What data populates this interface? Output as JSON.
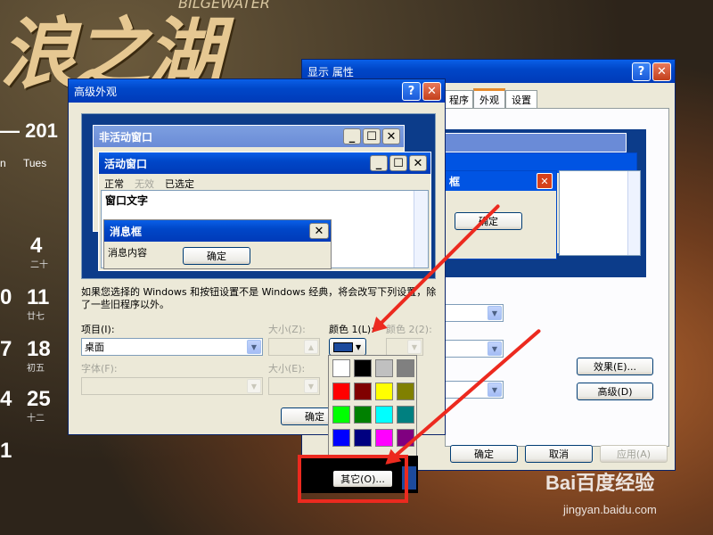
{
  "wallpaper": {
    "banner": "浪之湖",
    "subtitle": "BILGEWATER",
    "year": "— 201",
    "day_tue": "Tues",
    "day_n": "n",
    "dates": [
      {
        "n": "4",
        "l": "二十"
      },
      {
        "n": "11",
        "l": "廿七"
      },
      {
        "n": "18",
        "l": "初五"
      },
      {
        "n": "25",
        "l": "十二"
      }
    ],
    "left_nums": [
      "0",
      "7",
      "4",
      "1"
    ]
  },
  "display_window": {
    "title": "显示 属性",
    "tabs": [
      "程序",
      "外观",
      "设置"
    ],
    "preview_dialog_title": "框",
    "preview_ok": "确定",
    "buttons": {
      "effects": "效果(E)...",
      "advanced": "高级(D)",
      "ok": "确定",
      "cancel": "取消",
      "apply": "应用(A)"
    }
  },
  "advanced_window": {
    "title": "高级外观",
    "preview": {
      "inactive_title": "非活动窗口",
      "active_title": "活动窗口",
      "menu": [
        "正常",
        "无效",
        "已选定"
      ],
      "window_text": "窗口文字",
      "msgbox_title": "消息框",
      "msgbox_text": "消息内容",
      "msgbox_ok": "确定"
    },
    "note": "如果您选择的 Windows 和按钮设置不是 Windows 经典，将会改写下列设置，除了一些旧程序以外。",
    "item_label": "项目(I):",
    "item_value": "桌面",
    "size_label": "大小(Z):",
    "color1_label": "颜色 1(L):",
    "color2_label": "颜色 2(2):",
    "font_label": "字体(F):",
    "size2_label": "大小(E):",
    "ok": "确定"
  },
  "color_picker": {
    "other_label": "其它(O)...",
    "colors": [
      "#ffffff",
      "#000000",
      "#c0c0c0",
      "#808080",
      "#ff0000",
      "#800000",
      "#ffff00",
      "#808000",
      "#00ff00",
      "#008000",
      "#00ffff",
      "#008080",
      "#0000ff",
      "#000080",
      "#ff00ff",
      "#800080"
    ],
    "selected_color": "#1c4a9c"
  },
  "watermark": {
    "brand": "Bai百度经验",
    "url": "jingyan.baidu.com"
  },
  "annotation": {
    "color": "#ec2a1f"
  }
}
